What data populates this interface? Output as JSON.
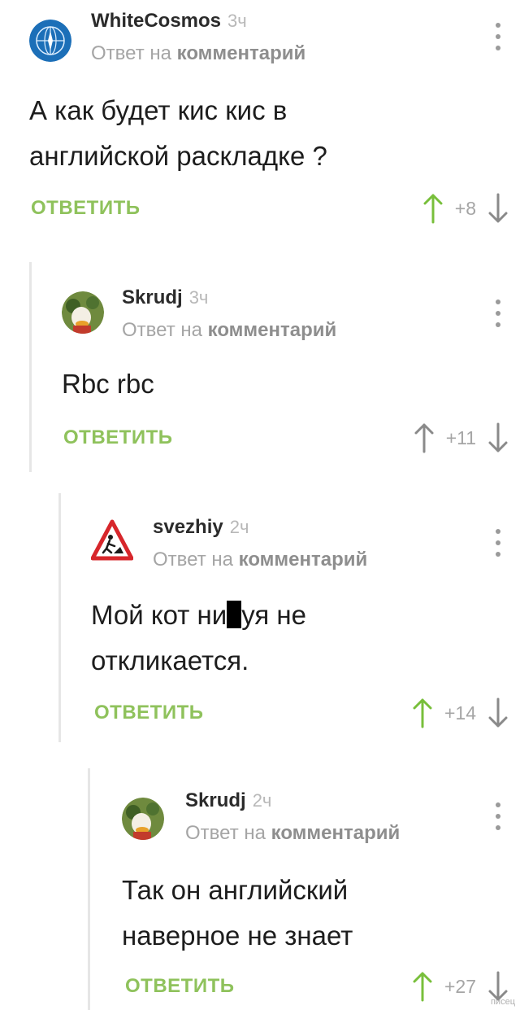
{
  "colors": {
    "accent_green": "#8fc25c",
    "upvote": "#78bf3b",
    "downvote": "#8a8a8a"
  },
  "reply_prefix": "Ответ на",
  "reply_target": "комментарий",
  "reply_label": "ОТВЕТИТЬ",
  "comments": [
    {
      "author": "WhiteCosmos",
      "time": "3ч",
      "text": "А как будет кис кис в\nанглийской раскладке ?",
      "score": "+8",
      "avatar": "globe-avatar"
    },
    {
      "author": "Skrudj",
      "time": "3ч",
      "text": "Rbc rbc",
      "score": "+11",
      "avatar": "duck-avatar"
    },
    {
      "author": "svezhiy",
      "time": "2ч",
      "text_part1": "Мой кот ни",
      "text_part2": "уя не\nоткликается.",
      "score": "+14",
      "avatar": "road-sign-avatar"
    },
    {
      "author": "Skrudj",
      "time": "2ч",
      "text": "Так он английский\nнаверное не знает",
      "score": "+27",
      "avatar": "duck-avatar"
    }
  ],
  "watermark": "писец"
}
